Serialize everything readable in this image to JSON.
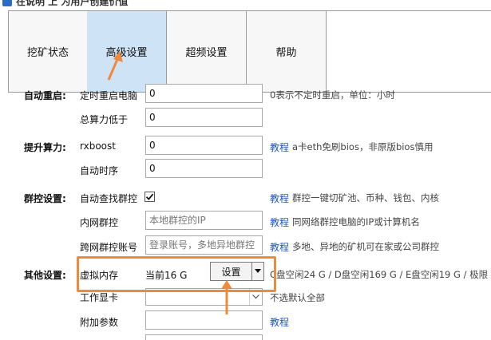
{
  "window": {
    "title": "在说明 上 为用户创建价值"
  },
  "tabs": [
    {
      "label": "挖矿状态",
      "active": false
    },
    {
      "label": "高级设置",
      "active": true
    },
    {
      "label": "超频设置",
      "active": false
    },
    {
      "label": "帮助",
      "active": false
    }
  ],
  "sections": {
    "auto_restart": {
      "label": "自动重启:",
      "timed_restart_label": "定时重启电脑",
      "timed_restart_value": "0",
      "timed_restart_hint": "0表示不定时重启，单位：小时",
      "hashrate_below_label": "总算力低于",
      "hashrate_below_value": "0"
    },
    "boost": {
      "label": "提升算力:",
      "rxboost_label": "rxboost",
      "rxboost_value": "0",
      "rxboost_link": "教程",
      "rxboost_hint": "a卡eth免刷bios，非原版bios慎用",
      "auto_timing_label": "自动时序",
      "auto_timing_value": "0"
    },
    "group_control": {
      "label": "群控设置:",
      "auto_find_label": "自动查找群控",
      "auto_find_checked": true,
      "auto_find_link": "教程",
      "auto_find_hint": "群控一键切矿池、币种、钱包、内核",
      "lan_label": "内网群控",
      "lan_placeholder": "本地群控的IP",
      "lan_link": "教程",
      "lan_hint": "同网络群控电脑的IP或计算机名",
      "wan_label": "跨网群控账号",
      "wan_placeholder": "登录账号，多地异地群控",
      "wan_link": "教程",
      "wan_hint": "多地、异地的矿机可在家或公司群控"
    },
    "other": {
      "label": "其他设置:",
      "vmem_label": "虚拟内存",
      "vmem_current": "当前16 G",
      "vmem_button": "设置",
      "vmem_hint": "C盘空闲24 G / D盘空闲169 G / E盘空闲19 G / 极限",
      "gpu_label": "工作显卡",
      "gpu_hint": "不选默认全部",
      "extra_params_label": "附加参数",
      "extra_params_value": "",
      "extra_params_link": "教程"
    }
  },
  "annotations": {
    "color": "#f0893a"
  }
}
